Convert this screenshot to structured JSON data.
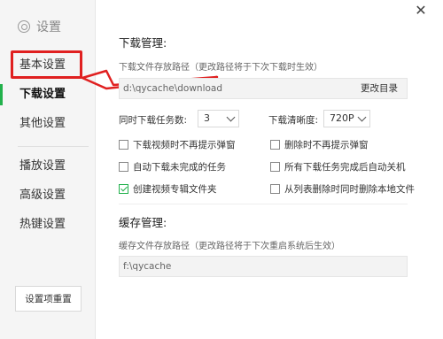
{
  "sidebar": {
    "title": "设置",
    "items": [
      {
        "label": "基本设置"
      },
      {
        "label": "下载设置"
      },
      {
        "label": "其他设置"
      },
      {
        "label": "播放设置"
      },
      {
        "label": "高级设置"
      },
      {
        "label": "热键设置"
      }
    ],
    "reset_label": "设置项重置"
  },
  "download": {
    "title": "下载管理:",
    "path_label": "下载文件存放路径（更改路径将于下次下载时生效）",
    "path_value": "d:\\qycache\\download",
    "change_dir_label": "更改目录",
    "tasks_label": "同时下载任务数:",
    "tasks_value": "3",
    "quality_label": "下载清晰度:",
    "quality_value": "720P",
    "options": [
      {
        "label": "下载视频时不再提示弹窗",
        "checked": false
      },
      {
        "label": "删除时不再提示弹窗",
        "checked": false
      },
      {
        "label": "自动下载未完成的任务",
        "checked": false
      },
      {
        "label": "所有下载任务完成后自动关机",
        "checked": false
      },
      {
        "label": "创建视频专辑文件夹",
        "checked": true
      },
      {
        "label": "从列表删除时同时删除本地文件",
        "checked": false
      }
    ]
  },
  "cache": {
    "title": "缓存管理:",
    "path_label": "缓存文件存放路径（更改路径将于下次重启系统后生效）",
    "path_value": "f:\\qycache"
  },
  "colors": {
    "accent": "#22b14c",
    "highlight": "#e02020"
  }
}
